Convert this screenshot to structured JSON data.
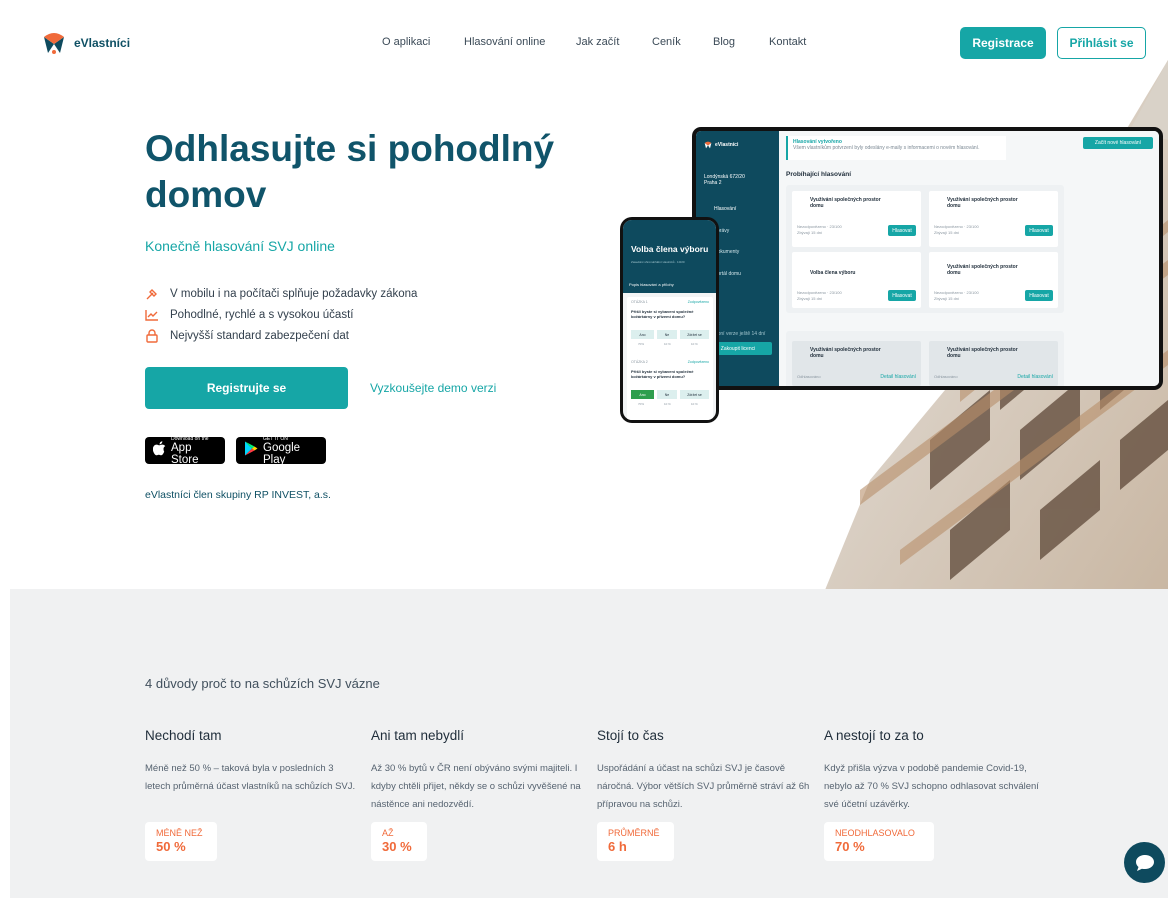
{
  "brand": {
    "name": "eVlastníci"
  },
  "nav": {
    "items": [
      "O aplikaci",
      "Hlasování online",
      "Jak začít",
      "Ceník",
      "Blog",
      "Kontakt"
    ],
    "register_label": "Registrace",
    "login_label": "Přihlásit se"
  },
  "hero": {
    "title": "Odhlasujte si pohodlný domov",
    "subtitle": "Konečně hlasování SVJ online",
    "features": [
      {
        "icon": "hammer-icon",
        "text": "V mobilu i na počítači splňuje požadavky zákona"
      },
      {
        "icon": "chart-icon",
        "text": "Pohodlné, rychlé a s vysokou účastí"
      },
      {
        "icon": "lock-icon",
        "text": "Nejvyšší standard zabezpečení dat"
      }
    ],
    "cta_label": "Registrujte se",
    "demo_label": "Vyzkoušejte demo verzi",
    "app_store": {
      "small": "Download on the",
      "big": "App Store"
    },
    "google_play": {
      "small": "GET IT ON",
      "big": "Google Play"
    },
    "group_text": "eVlastníci člen skupiny RP INVEST, a.s."
  },
  "tablet": {
    "brand": "eVlastníci",
    "address": "Londýnská 672/20\nPraha 2",
    "menu": [
      "Hlasování",
      "Zprávy",
      "Dokumenty",
      "Portál domu"
    ],
    "notice_title": "Hlasování vytvořeno",
    "notice_text": "Všem vlastníkům potvrzení byly odeslány e-maily s informacemi o novém hlasování.",
    "new_vote_label": "Začít nové hlasování",
    "section_title": "Probíhající hlasování",
    "cards": [
      {
        "title": "Využívání společných prostor domu",
        "meta": "Nezodpovězeno · 23/100\nZbývají 15 dní",
        "button": "Hlasovat"
      },
      {
        "title": "Využívání společných prostor domu",
        "meta": "Nezodpovězeno · 23/100\nZbývají 15 dní",
        "button": "Hlasovat"
      },
      {
        "title": "Volba člena výboru",
        "meta": "Nezodpovězeno · 23/100\nZbývají 15 dní",
        "button": "Hlasovat"
      },
      {
        "title": "Využívání společných prostor domu",
        "meta": "Nezodpovězeno · 23/100\nZbývají 15 dní",
        "button": "Hlasovat"
      }
    ],
    "done_cards": [
      {
        "title": "Využívání společných prostor domu",
        "meta": "Odhlasováno",
        "link": "Detail hlasování"
      },
      {
        "title": "Využívání společných prostor domu",
        "meta": "Odhlasováno",
        "link": "Detail hlasování"
      }
    ],
    "buy_label": "Zakoupit licenci",
    "trial_text": "Zkušební verze ještě 14 dní"
  },
  "phone": {
    "title": "Volba člena výboru",
    "subtitle": "Zasedání shromáždění vlastníků · 10/20",
    "section": "Popis hlasování a přílohy",
    "q1_label": "OTÁZKA 1",
    "q2_label": "OTÁZKA 2",
    "status": "Zodpovězeno",
    "question": "Přišli byste si vybavení společné kočárkárny v přízemí domu?",
    "answers": [
      "Ano",
      "Ne",
      "Zdržet se"
    ],
    "percents": [
      "70%",
      "10 %",
      "10 %"
    ]
  },
  "reasons": {
    "title": "4 důvody proč to na schůzích SVJ vázne",
    "items": [
      {
        "heading": "Nechodí tam",
        "text": "Méně než 50 % – taková byla v posledních 3 letech průměrná účast vlastníků na schůzích SVJ.",
        "badge_label": "MÉNĚ NEŽ",
        "badge_value": "50 %"
      },
      {
        "heading": "Ani tam nebydlí",
        "text": "Až 30 % bytů v ČR není obýváno svými majiteli. I kdyby chtěli přijet, někdy se o schůzi vyvěšené na nástěnce ani nedozvědí.",
        "badge_label": "AŽ",
        "badge_value": "30 %"
      },
      {
        "heading": "Stojí to čas",
        "text": "Uspořádání a účast na schůzi SVJ je časově náročná. Výbor větších SVJ průměrně stráví až 6h přípravou na schůzi.",
        "badge_label": "PRŮMĚRNĚ",
        "badge_value": "6 h"
      },
      {
        "heading": "A nestojí to za to",
        "text": "Když přišla výzva v podobě pandemie Covid-19, nebylo až 70 % SVJ schopno odhlasovat schválení své účetní uzávěrky.",
        "badge_label": "NEODHLASOVALO",
        "badge_value": "70 %"
      }
    ]
  },
  "colors": {
    "primary": "#16a6a6",
    "dark": "#0e4a5e",
    "accent": "#f06a3a"
  }
}
